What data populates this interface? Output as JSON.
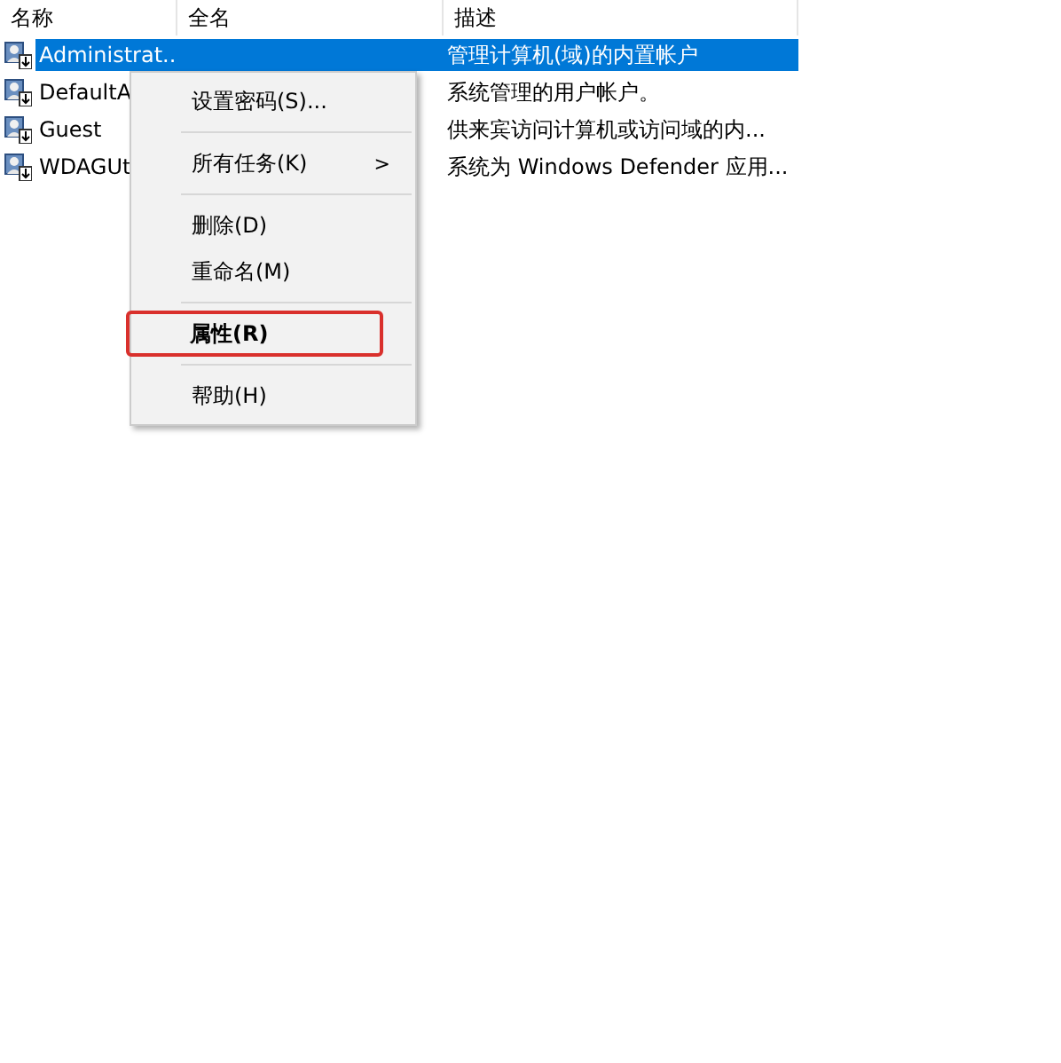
{
  "table": {
    "columns": [
      "名称",
      "全名",
      "描述"
    ],
    "rows": [
      {
        "name": "Administrat...",
        "full_name": "",
        "description": "管理计算机(域)的内置帐户",
        "selected": true
      },
      {
        "name": "DefaultA",
        "full_name": "",
        "description": "系统管理的用户帐户。",
        "selected": false
      },
      {
        "name": "Guest",
        "full_name": "",
        "description": "供来宾访问计算机或访问域的内...",
        "selected": false
      },
      {
        "name": "WDAGUt",
        "full_name": "",
        "description": "系统为 Windows Defender 应用...",
        "selected": false
      }
    ]
  },
  "context_menu": {
    "groups": [
      [
        {
          "label": "设置密码(S)...",
          "bold": false,
          "highlighted": false
        }
      ],
      [
        {
          "label": "所有任务(K)",
          "arrow": ">",
          "bold": false,
          "highlighted": false
        }
      ],
      [
        {
          "label": "删除(D)",
          "bold": false,
          "highlighted": false
        },
        {
          "label": "重命名(M)",
          "bold": false,
          "highlighted": false
        }
      ],
      [
        {
          "label": "属性(R)",
          "bold": true,
          "highlighted": true
        }
      ],
      [
        {
          "label": "帮助(H)",
          "bold": false,
          "highlighted": false
        }
      ]
    ]
  }
}
